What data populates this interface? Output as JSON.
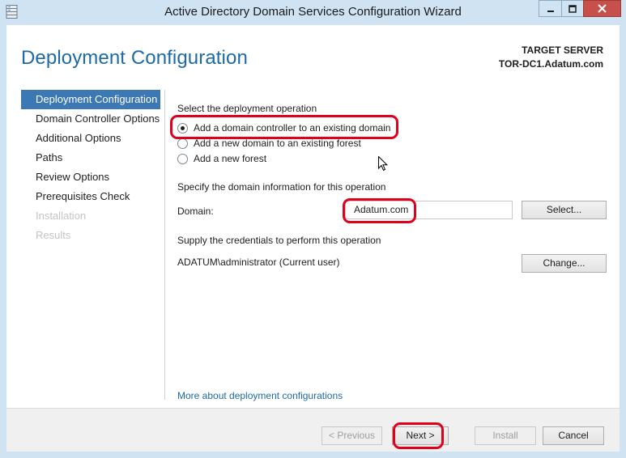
{
  "window": {
    "title": "Active Directory Domain Services Configuration Wizard",
    "app_icon": "server-manager-icon",
    "controls": [
      "minimize-icon",
      "maximize-icon",
      "close-icon"
    ]
  },
  "header": {
    "heading": "Deployment Configuration",
    "target_label": "TARGET SERVER",
    "target_name": "TOR-DC1.Adatum.com"
  },
  "nav": {
    "items": [
      {
        "label": "Deployment Configuration",
        "state": "active"
      },
      {
        "label": "Domain Controller Options",
        "state": "enabled"
      },
      {
        "label": "Additional Options",
        "state": "enabled"
      },
      {
        "label": "Paths",
        "state": "enabled"
      },
      {
        "label": "Review Options",
        "state": "enabled"
      },
      {
        "label": "Prerequisites Check",
        "state": "enabled"
      },
      {
        "label": "Installation",
        "state": "disabled"
      },
      {
        "label": "Results",
        "state": "disabled"
      }
    ]
  },
  "deployment": {
    "prompt": "Select the deployment operation",
    "options": [
      {
        "label": "Add a domain controller to an existing domain",
        "checked": true
      },
      {
        "label": "Add a new domain to an existing forest",
        "checked": false
      },
      {
        "label": "Add a new forest",
        "checked": false
      }
    ]
  },
  "domain_info": {
    "prompt": "Specify the domain information for this operation",
    "domain_label": "Domain:",
    "domain_value": "Adatum.com",
    "select_button": "Select..."
  },
  "credentials": {
    "prompt": "Supply the credentials to perform this operation",
    "current_user": "ADATUM\\administrator (Current user)",
    "change_button": "Change..."
  },
  "more_link": "More about deployment configurations",
  "footer": {
    "previous": "< Previous",
    "next": "Next >",
    "install": "Install",
    "cancel": "Cancel"
  },
  "colors": {
    "accent": "#1e6aa8",
    "nav_active": "#3c78b4",
    "annotation": "#e0001c",
    "close_button": "#c7504a"
  }
}
